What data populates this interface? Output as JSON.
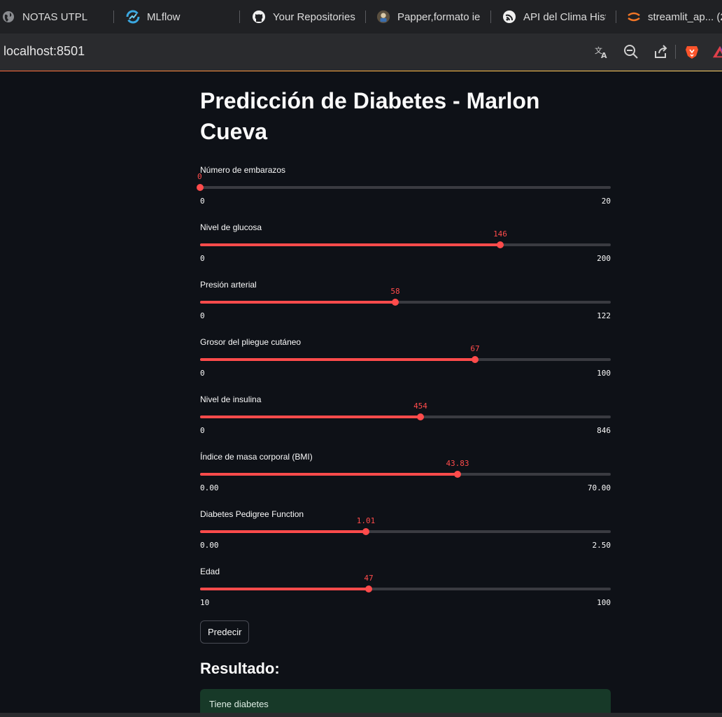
{
  "bookmarks": [
    {
      "label": "NOTAS UTPL",
      "icon": "globe-icon"
    },
    {
      "label": "MLflow",
      "icon": "mlflow-icon"
    },
    {
      "label": "Your Repositories",
      "icon": "github-icon"
    },
    {
      "label": "Papper,formato ie",
      "icon": "overleaf-icon"
    },
    {
      "label": "API del Clima Hist",
      "icon": "openweather-icon"
    },
    {
      "label": "streamlit_ap... (2",
      "icon": "jupyter-icon"
    }
  ],
  "address_bar": {
    "url": "localhost:8501"
  },
  "toolbar_icons": [
    "translate-icon",
    "zoom-out-icon",
    "share-icon",
    "brave-icon",
    "brave-rewards-icon"
  ],
  "colors": {
    "accent": "#ff4b4b",
    "background": "#0e1117",
    "success_bg": "#173928"
  },
  "page": {
    "title_line1": "Predicción de Diabetes - Marlon",
    "title_line2": "Cueva"
  },
  "sliders": [
    {
      "label": "Número de embarazos",
      "value": "0",
      "min": "0",
      "max": "20",
      "fraction": 0.0
    },
    {
      "label": "Nivel de glucosa",
      "value": "146",
      "min": "0",
      "max": "200",
      "fraction": 0.73
    },
    {
      "label": "Presión arterial",
      "value": "58",
      "min": "0",
      "max": "122",
      "fraction": 0.4754
    },
    {
      "label": "Grosor del pliegue cutáneo",
      "value": "67",
      "min": "0",
      "max": "100",
      "fraction": 0.67
    },
    {
      "label": "Nivel de insulina",
      "value": "454",
      "min": "0",
      "max": "846",
      "fraction": 0.5366
    },
    {
      "label": "Índice de masa corporal (BMI)",
      "value": "43.83",
      "min": "0.00",
      "max": "70.00",
      "fraction": 0.6261
    },
    {
      "label": "Diabetes Pedigree Function",
      "value": "1.01",
      "min": "0.00",
      "max": "2.50",
      "fraction": 0.404
    },
    {
      "label": "Edad",
      "value": "47",
      "min": "10",
      "max": "100",
      "fraction": 0.4111
    }
  ],
  "predict_button": {
    "label": "Predecir"
  },
  "result": {
    "heading": "Resultado:",
    "message": "Tiene diabetes"
  }
}
